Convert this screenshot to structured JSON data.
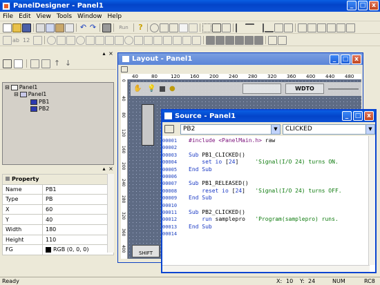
{
  "window": {
    "title": "PanelDesigner - Panel1",
    "minimize": "_",
    "maximize": "□",
    "close": "x"
  },
  "menu": [
    "File",
    "Edit",
    "View",
    "Tools",
    "Window",
    "Help"
  ],
  "toolbar1": {
    "run_label": "Run"
  },
  "toolbar2": {
    "text_ab": "ab",
    "text_12": "12"
  },
  "tree": {
    "root": "Panel1",
    "child": "Panel1",
    "items": [
      "PB1",
      "PB2"
    ]
  },
  "properties": {
    "header": "Property",
    "rows": [
      {
        "name": "Name",
        "value": "PB1"
      },
      {
        "name": "Type",
        "value": "PB"
      },
      {
        "name": "X",
        "value": "60"
      },
      {
        "name": "Y",
        "value": "40"
      },
      {
        "name": "Width",
        "value": "180"
      },
      {
        "name": "Height",
        "value": "110"
      },
      {
        "name": "FG",
        "value": "RGB (0, 0, 0)"
      }
    ]
  },
  "layout_window": {
    "title": "Layout - Panel1",
    "ruler_marks": [
      "40",
      "80",
      "120",
      "160",
      "200",
      "240",
      "280",
      "320",
      "360",
      "400",
      "440",
      "480"
    ],
    "ruler_v_marks": [
      "0",
      "40",
      "80",
      "120",
      "160",
      "200",
      "240",
      "280",
      "320",
      "360",
      "400"
    ],
    "wdto_label": "WDTO",
    "shift_label": "SHIFT"
  },
  "source_window": {
    "title": "Source - Panel1",
    "object_select": "PB2",
    "event_select": "CLICKED",
    "lines": [
      {
        "n": "00001",
        "code": "#include <PanelMain.h> raw"
      },
      {
        "n": "00002",
        "code": ""
      },
      {
        "n": "00003",
        "code": "Sub PB1_CLICKED()"
      },
      {
        "n": "00004",
        "code": "    set io [24]     'Signal(I/O 24) turns ON."
      },
      {
        "n": "00005",
        "code": "End Sub"
      },
      {
        "n": "00006",
        "code": ""
      },
      {
        "n": "00007",
        "code": "Sub PB1_RELEASED()"
      },
      {
        "n": "00008",
        "code": "    reset io [24]   'Signal(I/O 24) turns OFF."
      },
      {
        "n": "00009",
        "code": "End Sub"
      },
      {
        "n": "00010",
        "code": ""
      },
      {
        "n": "00011",
        "code": "Sub PB2_CLICKED()"
      },
      {
        "n": "00012",
        "code": "    run samplepro   'Program(samplepro) runs."
      },
      {
        "n": "00013",
        "code": "End Sub"
      },
      {
        "n": "00014",
        "code": ""
      }
    ]
  },
  "statusbar": {
    "left": "Ready",
    "x": "X:",
    "xval": "10",
    "y": "Y:",
    "yval": "24",
    "num": "NUM",
    "rc": "RC8"
  },
  "colors": {
    "title_blue": "#0344c9",
    "canvas": "#5e6b84",
    "keyword": "#1a39c4",
    "comment": "#0c7a0c"
  }
}
